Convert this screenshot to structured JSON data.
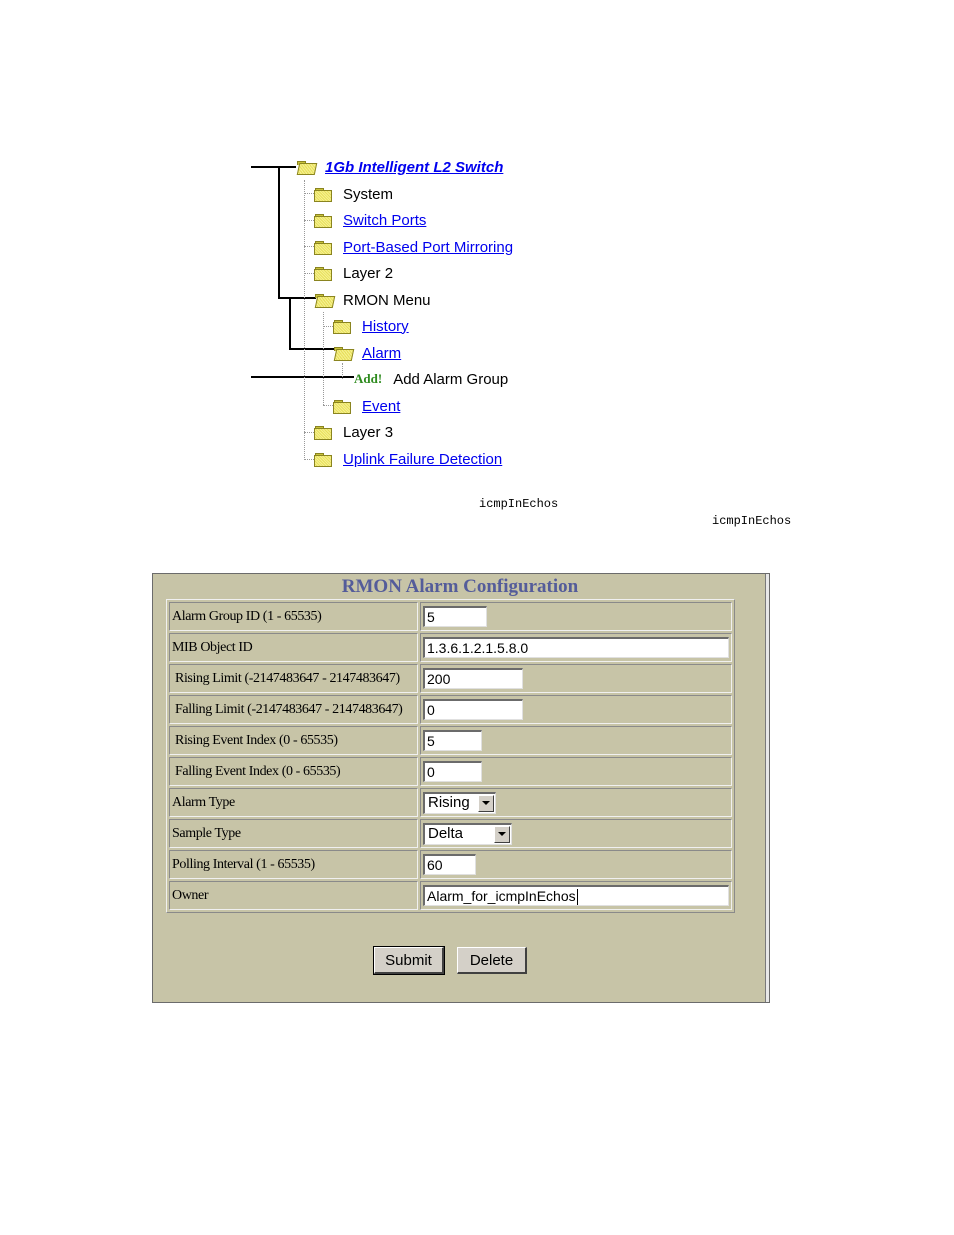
{
  "tree": {
    "root": {
      "label": "1Gb Intelligent L2 Switch",
      "link": true
    },
    "items": [
      {
        "label": "System",
        "link": false
      },
      {
        "label": "Switch Ports",
        "link": true
      },
      {
        "label": "Port-Based Port Mirroring",
        "link": true
      },
      {
        "label": "Layer 2",
        "link": false
      },
      {
        "label": "RMON Menu",
        "link": false,
        "open": true
      },
      {
        "label": "History",
        "link": true
      },
      {
        "label": "Alarm",
        "link": true,
        "open": true
      },
      {
        "label": "Add Alarm Group",
        "badge": "Add!",
        "link": false
      },
      {
        "label": "Event",
        "link": true
      },
      {
        "label": "Layer 3",
        "link": false
      },
      {
        "label": "Uplink Failure Detection",
        "link": true
      }
    ]
  },
  "mono_text": [
    "icmpInEchos",
    "icmpInEchos"
  ],
  "panel": {
    "title": "RMON Alarm Configuration",
    "fields": [
      {
        "label": "Alarm Group ID (1 - 65535)",
        "value": "5",
        "type": "input"
      },
      {
        "label": "MIB Object ID",
        "value": "1.3.6.1.2.1.5.8.0",
        "type": "input"
      },
      {
        "label": "Rising Limit (-2147483647 - 2147483647)",
        "value": "200",
        "type": "input"
      },
      {
        "label": "Falling Limit (-2147483647 - 2147483647)",
        "value": "0",
        "type": "input"
      },
      {
        "label": "Rising Event Index (0 - 65535)",
        "value": "5",
        "type": "input"
      },
      {
        "label": "Falling Event Index (0 - 65535)",
        "value": "0",
        "type": "input"
      },
      {
        "label": "Alarm Type",
        "value": "Rising",
        "type": "select"
      },
      {
        "label": "Sample Type",
        "value": "Delta",
        "type": "select"
      },
      {
        "label": "Polling Interval (1 - 65535)",
        "value": "60",
        "type": "input"
      },
      {
        "label": "Owner",
        "value": "Alarm_for_icmpInEchos",
        "type": "input"
      }
    ],
    "buttons": {
      "submit": "Submit",
      "delete": "Delete"
    }
  }
}
